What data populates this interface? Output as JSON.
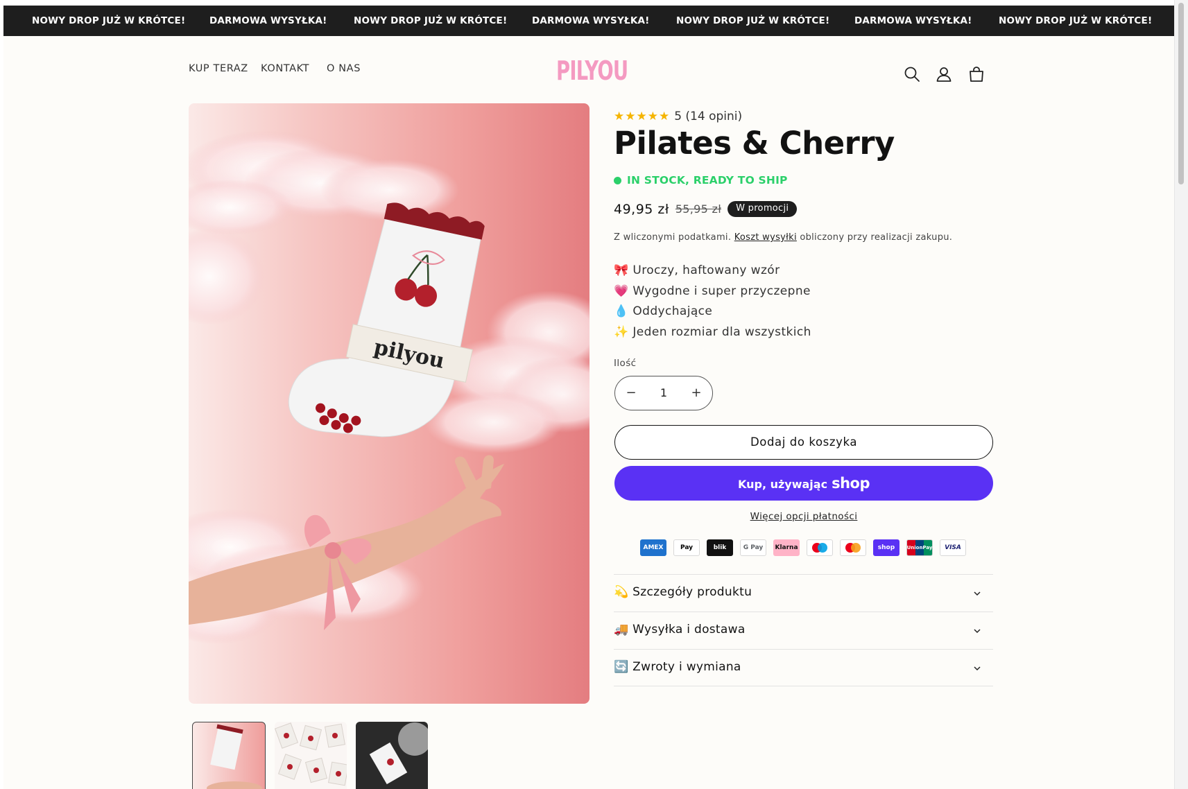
{
  "announcement": {
    "items": [
      "NOWY DROP JUŻ W KRÓTCE!",
      "DARMOWA WYSYŁKA!",
      "NOWY DROP JUŻ W KRÓTCE!",
      "DARMOWA WYSYŁKA!",
      "NOWY DROP JUŻ W KRÓTCE!",
      "DARMOWA WYSYŁKA!",
      "NOWY DROP JUŻ W KRÓTCE!"
    ]
  },
  "header": {
    "nav": [
      "KUP TERAZ",
      "KONTAKT",
      "O NAS"
    ],
    "logo": "PILYOU",
    "icons": [
      "search-icon",
      "account-icon",
      "cart-icon"
    ]
  },
  "product": {
    "rating_stars": "★★★★★",
    "rating_text": "5 (14 opini)",
    "rating_value": 5,
    "title": "Pilates & Cherry",
    "stock": "IN STOCK, READY TO SHIP",
    "price": "49,95 zł",
    "price_old": "55,95 zł",
    "sale_badge": "W promocji",
    "tax_note_before": "Z wliczonymi podatkami.",
    "tax_note_link": "Koszt wysyłki",
    "tax_note_after": "obliczony przy realizacji zakupu.",
    "features": [
      "🎀 Uroczy, haftowany wzór",
      "💗 Wygodne i super przyczepne",
      "💧 Oddychające",
      "✨ Jeden rozmiar dla wszystkich"
    ],
    "quantity_label": "Ilość",
    "quantity": "1",
    "qty_minus": "−",
    "qty_plus": "+",
    "add_to_cart": "Dodaj do koszyka",
    "shop_pay_prefix": "Kup, używając",
    "shop_pay_word": "shop",
    "more_payment": "Więcej opcji płatności",
    "payment_methods": [
      "AMEX",
      "Pay",
      "blik",
      "G Pay",
      "Klarna",
      "maestro",
      "mastercard",
      "shop",
      "UnionPay",
      "VISA"
    ],
    "accordions": [
      "💫 Szczegóły produktu",
      "🚚 Wysyłka i dostawa",
      "🔄 Zwroty i wymiana"
    ],
    "image_text": "pilyou"
  },
  "colors": {
    "accent_pink": "#f49ac1",
    "stock_green": "#2bd06a",
    "shop_purple": "#5a31f4",
    "announce_bg": "#1e1e1e"
  }
}
